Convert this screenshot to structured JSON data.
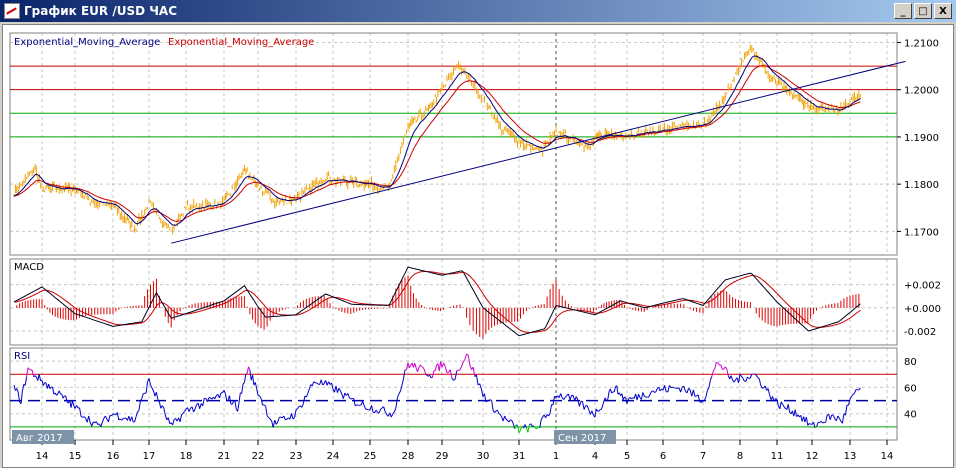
{
  "window": {
    "title": "График EUR /USD  ЧАС",
    "buttons": {
      "minimize": "_",
      "maximize": "□",
      "close": "X"
    }
  },
  "colors": {
    "price": "#f0a000",
    "ema_fast": "#000080",
    "ema_slow": "#cc0000",
    "macd_hist": "#dd0000",
    "rsi": "#0000cc",
    "rsi_overbought": "#cc00cc",
    "rsi_oversold": "#00cc00",
    "level_red": "#cc0000",
    "level_green": "#00aa00",
    "trendline": "#000080"
  },
  "chart_data": [
    {
      "type": "line",
      "panel": "price",
      "legend": [
        "Exponential_Moving_Average",
        "Exponential_Moving_Average"
      ],
      "y_ticks": [
        "1.2100",
        "1.2000",
        "1.1900",
        "1.1800",
        "1.1700"
      ],
      "ylim": [
        1.165,
        1.212
      ],
      "x_ticks": [
        "14",
        "15",
        "16",
        "17",
        "18",
        "21",
        "22",
        "23",
        "24",
        "25",
        "28",
        "29",
        "30",
        "31",
        "1",
        "4",
        "5",
        "6",
        "7",
        "8",
        "11",
        "12",
        "13",
        "14"
      ],
      "month_labels": [
        {
          "label": "Авг 2017",
          "at": "14"
        },
        {
          "label": "Сен 2017",
          "at": "1"
        }
      ],
      "horizontal_levels": [
        {
          "value": 1.205,
          "color": "red"
        },
        {
          "value": 1.2,
          "color": "red"
        },
        {
          "value": 1.195,
          "color": "green"
        },
        {
          "value": 1.19,
          "color": "green"
        }
      ],
      "trendline": {
        "from": [
          3.6,
          1.1675
        ],
        "to": [
          23.5,
          1.206
        ]
      },
      "price_points": [
        [
          -0.8,
          1.178
        ],
        [
          -0.2,
          1.1835
        ],
        [
          0,
          1.179
        ],
        [
          1,
          1.179
        ],
        [
          1.5,
          1.176
        ],
        [
          2,
          1.1755
        ],
        [
          2.6,
          1.1705
        ],
        [
          3,
          1.176
        ],
        [
          3.6,
          1.17
        ],
        [
          4,
          1.175
        ],
        [
          5,
          1.176
        ],
        [
          5.6,
          1.183
        ],
        [
          6,
          1.1795
        ],
        [
          6.5,
          1.176
        ],
        [
          7,
          1.177
        ],
        [
          7.8,
          1.1815
        ],
        [
          8,
          1.181
        ],
        [
          9,
          1.18
        ],
        [
          9.5,
          1.179
        ],
        [
          10,
          1.192
        ],
        [
          10.6,
          1.196
        ],
        [
          11,
          1.2
        ],
        [
          11.4,
          1.2055
        ],
        [
          12,
          1.198
        ],
        [
          12.5,
          1.192
        ],
        [
          13,
          1.189
        ],
        [
          13.6,
          1.187
        ],
        [
          14,
          1.191
        ],
        [
          14.8,
          1.188
        ],
        [
          15,
          1.19
        ],
        [
          16,
          1.1905
        ],
        [
          17,
          1.1915
        ],
        [
          18,
          1.1925
        ],
        [
          18.5,
          1.197
        ],
        [
          19,
          1.205
        ],
        [
          19.3,
          1.209
        ],
        [
          19.8,
          1.203
        ],
        [
          20,
          1.202
        ],
        [
          20.8,
          1.197
        ],
        [
          21,
          1.196
        ],
        [
          21.7,
          1.1955
        ],
        [
          22,
          1.1975
        ],
        [
          22.3,
          1.199
        ]
      ]
    },
    {
      "type": "line",
      "panel": "macd",
      "label": "MACD",
      "y_ticks": [
        "+0.002",
        "+0.000",
        "-0.002"
      ],
      "ylim": [
        -0.0032,
        0.0042
      ],
      "macd_points": [
        [
          -0.8,
          0.0005
        ],
        [
          0,
          0.0018
        ],
        [
          1,
          -0.0005
        ],
        [
          2,
          -0.0016
        ],
        [
          2.8,
          -0.0012
        ],
        [
          3.2,
          0.0013
        ],
        [
          3.6,
          -0.0009
        ],
        [
          4,
          -0.0005
        ],
        [
          5,
          0.0006
        ],
        [
          5.6,
          0.0019
        ],
        [
          6.2,
          -0.0008
        ],
        [
          7,
          -0.0006
        ],
        [
          7.8,
          0.0012
        ],
        [
          8.5,
          0.0003
        ],
        [
          9.5,
          0.0002
        ],
        [
          10,
          0.0035
        ],
        [
          11,
          0.0028
        ],
        [
          11.5,
          0.0032
        ],
        [
          12,
          0.0
        ],
        [
          13,
          -0.0024
        ],
        [
          13.7,
          -0.0018
        ],
        [
          14,
          0.0002
        ],
        [
          15,
          -0.0006
        ],
        [
          15.8,
          0.0006
        ],
        [
          16.5,
          0.0
        ],
        [
          17.5,
          0.0008
        ],
        [
          18,
          0.0002
        ],
        [
          18.6,
          0.0024
        ],
        [
          19.3,
          0.003
        ],
        [
          20,
          0.0005
        ],
        [
          20.9,
          -0.002
        ],
        [
          21.7,
          -0.0012
        ],
        [
          22.3,
          0.0004
        ]
      ]
    },
    {
      "type": "line",
      "panel": "rsi",
      "label": "RSI",
      "y_ticks": [
        "80",
        "60",
        "40"
      ],
      "ylim": [
        20,
        90
      ],
      "levels": [
        70,
        50,
        30
      ],
      "rsi_points": [
        [
          -0.8,
          60
        ],
        [
          -0.6,
          50
        ],
        [
          -0.4,
          74
        ],
        [
          0,
          65
        ],
        [
          1,
          45
        ],
        [
          1.6,
          30
        ],
        [
          2,
          40
        ],
        [
          2.6,
          35
        ],
        [
          3,
          65
        ],
        [
          3.6,
          30
        ],
        [
          4,
          42
        ],
        [
          5,
          55
        ],
        [
          5.4,
          45
        ],
        [
          5.7,
          75
        ],
        [
          6.4,
          32
        ],
        [
          7,
          40
        ],
        [
          7.5,
          65
        ],
        [
          8,
          60
        ],
        [
          8.5,
          50
        ],
        [
          9,
          45
        ],
        [
          9.6,
          40
        ],
        [
          10,
          78
        ],
        [
          10.7,
          70
        ],
        [
          11,
          78
        ],
        [
          11.3,
          68
        ],
        [
          11.6,
          85
        ],
        [
          12,
          55
        ],
        [
          12.5,
          38
        ],
        [
          13,
          28
        ],
        [
          13.5,
          30
        ],
        [
          13.8,
          40
        ],
        [
          14,
          55
        ],
        [
          14.5,
          50
        ],
        [
          15,
          40
        ],
        [
          15.6,
          60
        ],
        [
          16,
          50
        ],
        [
          16.8,
          58
        ],
        [
          17.5,
          60
        ],
        [
          18,
          50
        ],
        [
          18.4,
          80
        ],
        [
          18.8,
          65
        ],
        [
          19.4,
          70
        ],
        [
          20,
          48
        ],
        [
          20.6,
          40
        ],
        [
          21,
          30
        ],
        [
          21.5,
          38
        ],
        [
          21.8,
          35
        ],
        [
          22,
          50
        ],
        [
          22.3,
          60
        ]
      ]
    }
  ]
}
